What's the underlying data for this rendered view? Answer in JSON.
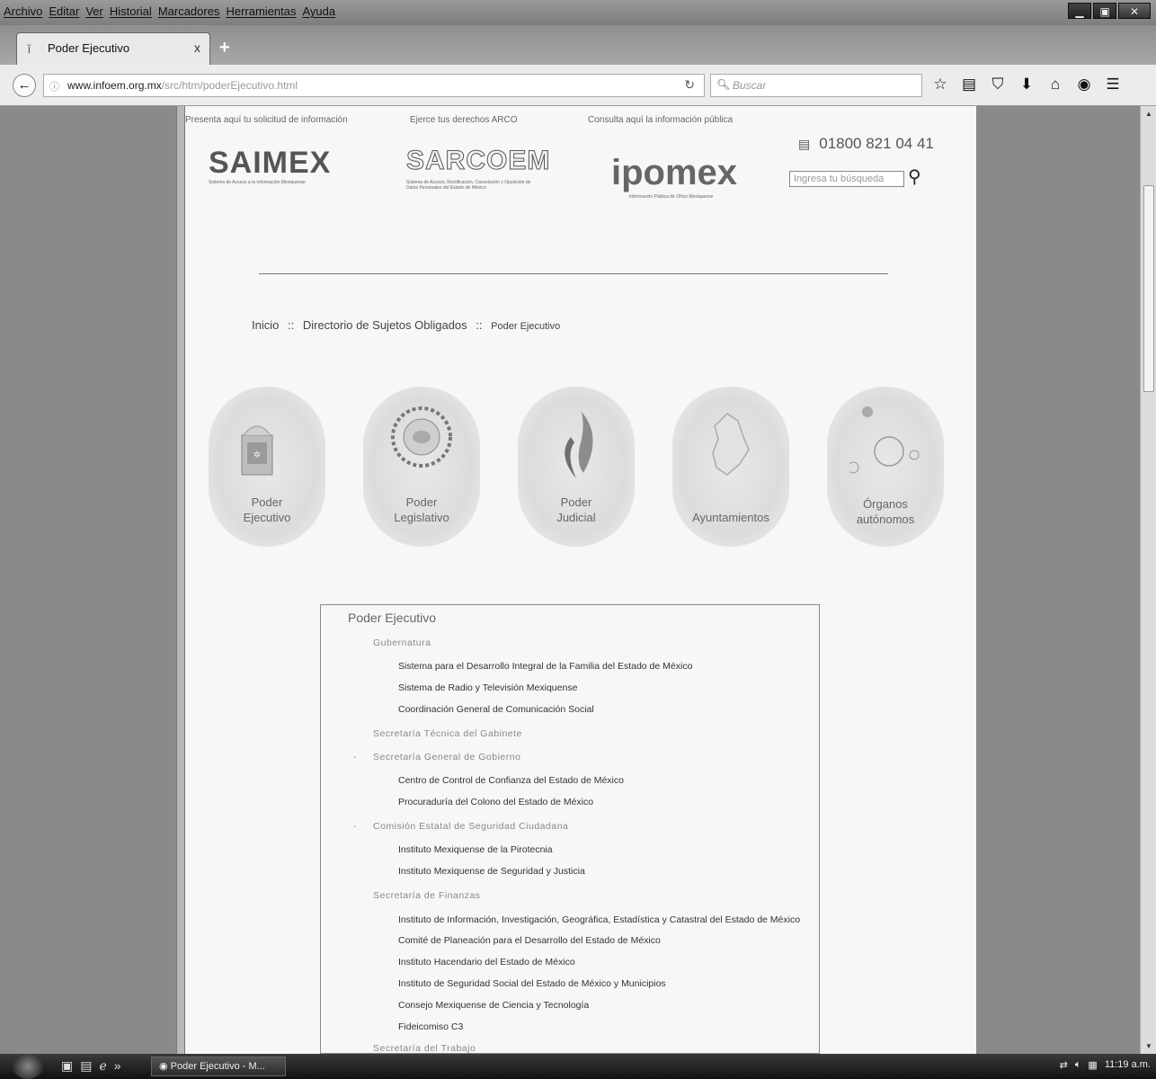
{
  "menubar": {
    "items": [
      "Archivo",
      "Editar",
      "Ver",
      "Historial",
      "Marcadores",
      "Herramientas",
      "Ayuda"
    ]
  },
  "tab": {
    "title": "Poder Ejecutivo",
    "close": "x",
    "new": "+"
  },
  "nav": {
    "url_domain": "www.infoem.org.mx",
    "url_path": "/src/htm/poderEjecutivo.html",
    "search_placeholder": "Buscar"
  },
  "header": {
    "saimex_label": "Presenta aquí tu solicitud de información",
    "saimex_logo": "SAIMEX",
    "saimex_sub": "Sistema de Acceso a la Información Mexiquense",
    "sarcoem_label": "Ejerce tus derechos ARCO",
    "sarcoem_logo": "SARCOEM",
    "sarcoem_sub": "Sistema de Acceso, Rectificación, Cancelación y Oposición de Datos Personales del Estado de México",
    "ipomex_label": "Consulta aquí la información pública",
    "ipomex_logo": "ipomex",
    "ipomex_sub": "Información Pública de Oficio Mexiquense",
    "phone": "01800 821 04 41",
    "search_placeholder": "Ingresa tu búsqueda"
  },
  "breadcrumb": {
    "home": "Inicio",
    "sep": "::",
    "directory": "Directorio de Sujetos Obligados",
    "current": "Poder Ejecutivo"
  },
  "categories": [
    {
      "line1": "Poder",
      "line2": "Ejecutivo"
    },
    {
      "line1": "Poder",
      "line2": "Legislativo"
    },
    {
      "line1": "Poder",
      "line2": "Judicial"
    },
    {
      "line1": "",
      "line2": "Ayuntamientos"
    },
    {
      "line1": "Órganos",
      "line2": "autónomos"
    }
  ],
  "panel": {
    "title": "Poder Ejecutivo",
    "rows": [
      {
        "text": "Gubernatura"
      },
      {
        "text": "Sistema para el Desarrollo Integral de la Familia del Estado de México"
      },
      {
        "text": "Sistema de Radio y Televisión Mexiquense"
      },
      {
        "text": "Coordinación General de Comunicación Social"
      },
      {
        "text": "Secretaría Técnica del Gabinete"
      },
      {
        "text": "Secretaría General de Gobierno"
      },
      {
        "text": "Centro de Control de Confianza del Estado de México"
      },
      {
        "text": "Procuraduría del Colono del Estado de México"
      },
      {
        "text": "Comisión Estatal de Seguridad Ciudadana"
      },
      {
        "text": "Instituto Mexiquense de la Pirotecnia"
      },
      {
        "text": "Instituto Mexiquense de Seguridad y Justicia"
      },
      {
        "text": "Secretaría de Finanzas"
      },
      {
        "text": "Instituto de Información, Investigación, Geográfica, Estadística y Catastral del Estado de México"
      },
      {
        "text": "Comité de Planeación para el Desarrollo del Estado de México"
      },
      {
        "text": "Instituto Hacendario del Estado de México"
      },
      {
        "text": "Instituto de Seguridad Social del Estado de México y Municipios"
      },
      {
        "text": "Consejo Mexiquense de Ciencia y Tecnología"
      },
      {
        "text": "Fideicomiso C3"
      },
      {
        "text": "Secretaría del Trabajo"
      }
    ],
    "toggle": "-"
  },
  "taskbar": {
    "task_label": "Poder Ejecutivo - M...",
    "chevrons": "»",
    "clock": "11:19 a.m."
  },
  "colors": {
    "page_bg": "#f7f7f7",
    "frame_bg": "#8a8a8a",
    "panel_border": "#888888"
  }
}
